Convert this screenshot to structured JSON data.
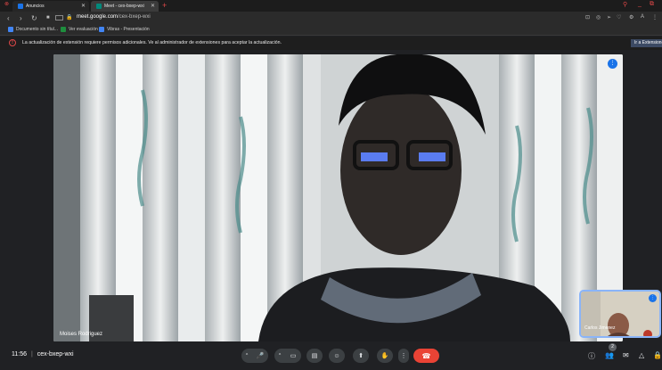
{
  "browser": {
    "tabs": [
      {
        "label": "Anuncios",
        "favicon_color": "#1a73e8"
      },
      {
        "label": "Meet - cex-bxep-wxi",
        "favicon_color": "#00897b"
      }
    ],
    "url_domain": "meet.google.com",
    "url_path": "/cex-bxep-wxi",
    "bookmarks": [
      {
        "label": "Documento sin títul...",
        "icon_color": "#4285f4"
      },
      {
        "label": "Ver evaluación",
        "icon_color": "#1e8e3e"
      },
      {
        "label": "Vibras - Presentación",
        "icon_color": "#4285f4"
      }
    ],
    "infobar": {
      "message": "La actualización de extensión requiere permisos adicionales. Ve al administrador de extensiones para aceptar la actualización.",
      "button": "Ir a Extensiones"
    }
  },
  "meeting": {
    "main_participant": "Moises Rodriguez",
    "self_participant": "Carlos Jimenez",
    "time": "11:56",
    "separator": "|",
    "code": "cex-bxep-wxi",
    "participant_count": "2"
  },
  "colors": {
    "hangup": "#ea4335",
    "accent": "#1a73e8",
    "bar": "#3c4043"
  }
}
